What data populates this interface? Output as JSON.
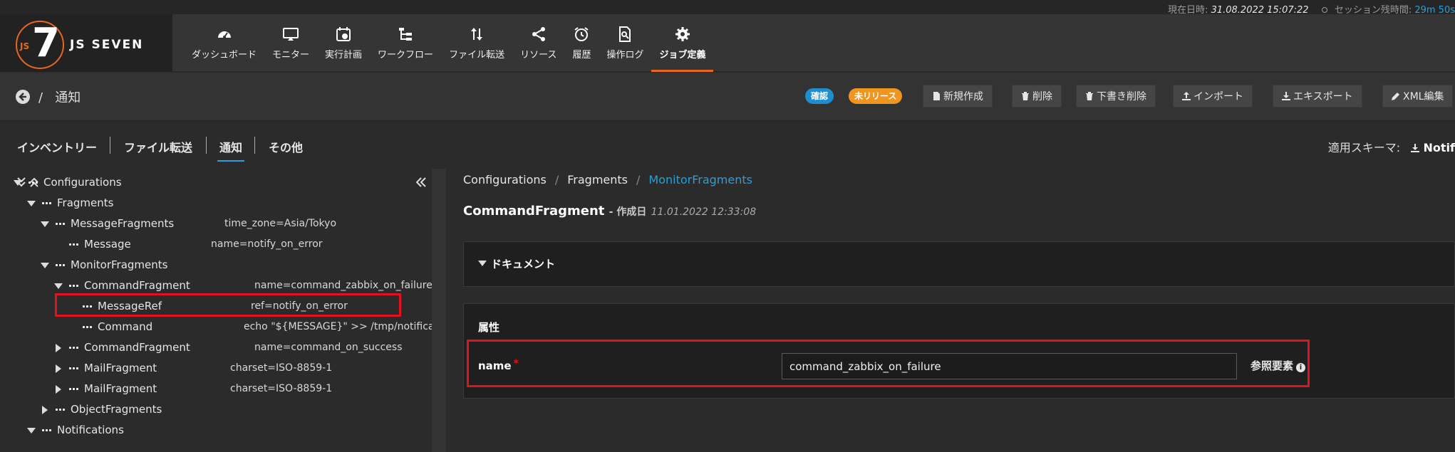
{
  "status": {
    "datetime_label": "現在日時:",
    "datetime_value": "31.08.2022 15:07:22",
    "session_label": "セッション残時間:",
    "session_value": "29m 50s"
  },
  "logo": {
    "js": "JS",
    "number": "7",
    "brand": "JS SEVEN"
  },
  "nav": [
    {
      "label": "ダッシュボード",
      "icon": "dashboard-icon"
    },
    {
      "label": "モニター",
      "icon": "monitor-icon"
    },
    {
      "label": "実行計画",
      "icon": "calendar-icon"
    },
    {
      "label": "ワークフロー",
      "icon": "workflow-icon"
    },
    {
      "label": "ファイル転送",
      "icon": "transfer-icon"
    },
    {
      "label": "リソース",
      "icon": "share-icon"
    },
    {
      "label": "履歴",
      "icon": "alarm-clock-icon"
    },
    {
      "label": "操作ログ",
      "icon": "audit-log-icon"
    },
    {
      "label": "ジョブ定義",
      "icon": "gear-icon",
      "active": true
    }
  ],
  "actionbar": {
    "page_title": "通知",
    "badge_confirm": "確認",
    "badge_unreleased": "未リリース",
    "buttons": {
      "new": "新規作成",
      "delete": "削除",
      "delete_draft": "下書き削除",
      "import": "インポート",
      "export": "エキスポート",
      "xml_edit": "XML編集"
    }
  },
  "tabs": {
    "items": [
      "インベントリー",
      "ファイル転送",
      "通知",
      "その他"
    ],
    "active": "通知",
    "schema_label": "適用スキーマ:",
    "schema_value": "Notif"
  },
  "tree": [
    {
      "label": "Configurations",
      "attr": "",
      "expanded": "down"
    },
    {
      "label": "Fragments",
      "attr": "",
      "expanded": "down"
    },
    {
      "label": "MessageFragments",
      "attr": "time_zone=Asia/Tokyo",
      "expanded": "down"
    },
    {
      "label": "Message",
      "attr": "name=notify_on_error",
      "expanded": ""
    },
    {
      "label": "MonitorFragments",
      "attr": "",
      "expanded": "down"
    },
    {
      "label": "CommandFragment",
      "attr": "name=command_zabbix_on_failure",
      "expanded": "down",
      "highlighted": true
    },
    {
      "label": "MessageRef",
      "attr": "ref=notify_on_error",
      "expanded": ""
    },
    {
      "label": "Command",
      "attr": "echo \"${MESSAGE}\" >> /tmp/notification.log",
      "expanded": ""
    },
    {
      "label": "CommandFragment",
      "attr": "name=command_on_success",
      "expanded": "right"
    },
    {
      "label": "MailFragment",
      "attr": "charset=ISO-8859-1",
      "expanded": "right"
    },
    {
      "label": "MailFragment",
      "attr": "charset=ISO-8859-1",
      "expanded": "right"
    },
    {
      "label": "ObjectFragments",
      "attr": "",
      "expanded": "right"
    },
    {
      "label": "Notifications",
      "attr": "",
      "expanded": "down"
    }
  ],
  "main": {
    "breadcrumb": [
      "Configurations",
      "Fragments",
      "MonitorFragments"
    ],
    "title": "CommandFragment",
    "created_label": "- 作成日",
    "created_date": "11.01.2022 12:33:08",
    "doc_section": "ドキュメント",
    "attr_section": "属性",
    "field_label": "name",
    "field_required": "*",
    "field_value": "command_zabbix_on_failure",
    "ref_link": "参照要素"
  },
  "colors": {
    "accent_orange": "#e8671e",
    "link_blue": "#2aa0d8",
    "highlight_red": "#e0141e",
    "badge_blue": "#1d8fd1",
    "badge_orange": "#f0961f"
  }
}
